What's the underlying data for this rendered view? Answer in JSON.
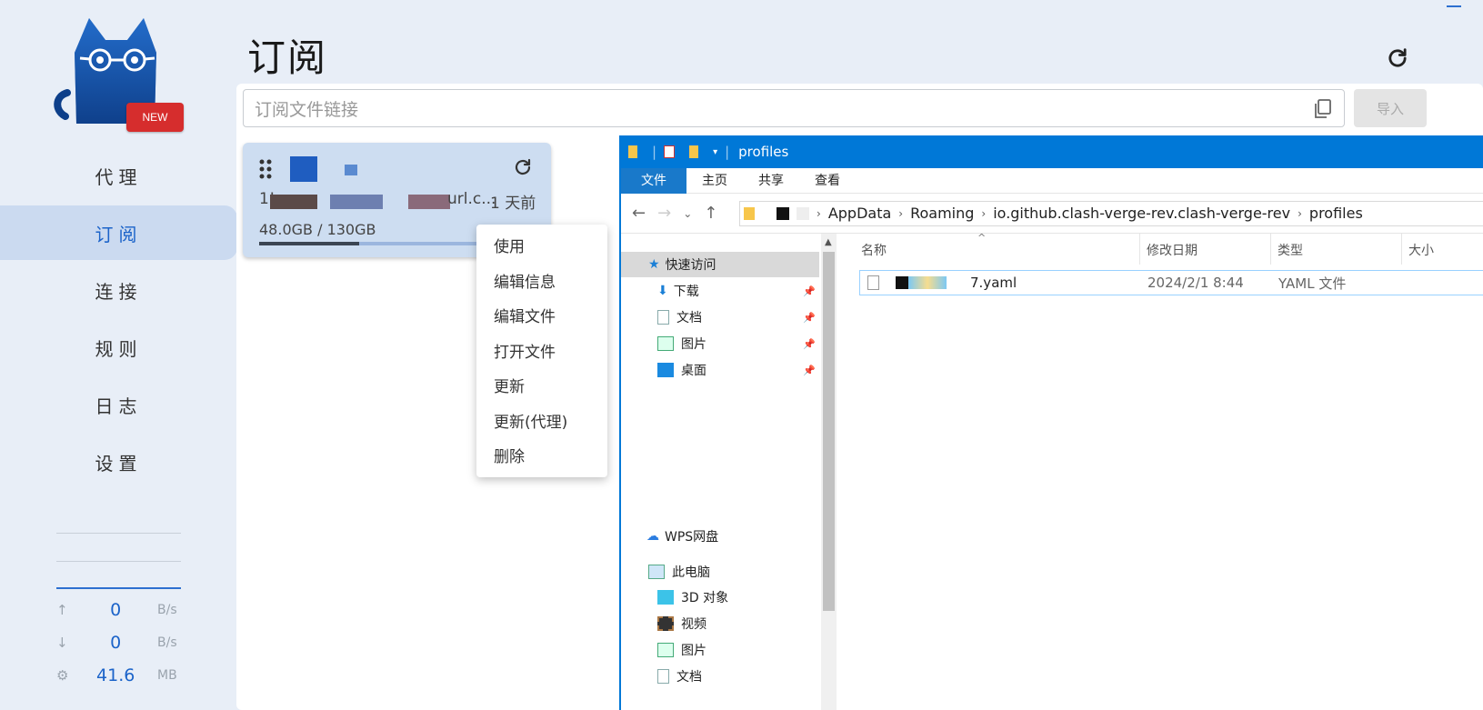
{
  "sidebar": {
    "new_badge": "NEW",
    "nav": [
      {
        "label": "代理",
        "active": false
      },
      {
        "label": "订阅",
        "active": true
      },
      {
        "label": "连接",
        "active": false
      },
      {
        "label": "规则",
        "active": false
      },
      {
        "label": "日志",
        "active": false
      },
      {
        "label": "设置",
        "active": false
      }
    ],
    "traffic": {
      "upload_value": "0",
      "upload_unit": "B/s",
      "download_value": "0",
      "download_unit": "B/s",
      "memory_value": "41.6",
      "memory_unit": "MB"
    }
  },
  "main": {
    "title": "订阅",
    "url_placeholder": "订阅文件链接",
    "import_label": "导入",
    "profile": {
      "sub_prefix": "1!",
      "url_fragment": "url.c...",
      "updated": "1 天前",
      "usage": "48.0GB / 130GB",
      "usage_fraction": 0.46
    },
    "context_menu": [
      "使用",
      "编辑信息",
      "编辑文件",
      "打开文件",
      "更新",
      "更新(代理)",
      "删除"
    ]
  },
  "explorer": {
    "title": "profiles",
    "tabs": [
      "文件",
      "主页",
      "共享",
      "查看"
    ],
    "breadcrumb": [
      "AppData",
      "Roaming",
      "io.github.clash-verge-rev.clash-verge-rev",
      "profiles"
    ],
    "nav_items": {
      "quick_access": "快速访问",
      "downloads": "下载",
      "documents": "文档",
      "pictures": "图片",
      "desktop": "桌面",
      "wps": "WPS网盘",
      "this_pc": "此电脑",
      "objects_3d": "3D 对象",
      "videos": "视频",
      "pictures2": "图片",
      "documents2": "文档"
    },
    "columns": {
      "name": "名称",
      "modified": "修改日期",
      "type": "类型",
      "size": "大小"
    },
    "file": {
      "name_suffix": "7.yaml",
      "modified": "2024/2/1 8:44",
      "type": "YAML 文件"
    }
  },
  "colors": {
    "accent": "#1b63c9",
    "explorer_blue": "#0078d7",
    "badge_red": "#d62d2d"
  }
}
